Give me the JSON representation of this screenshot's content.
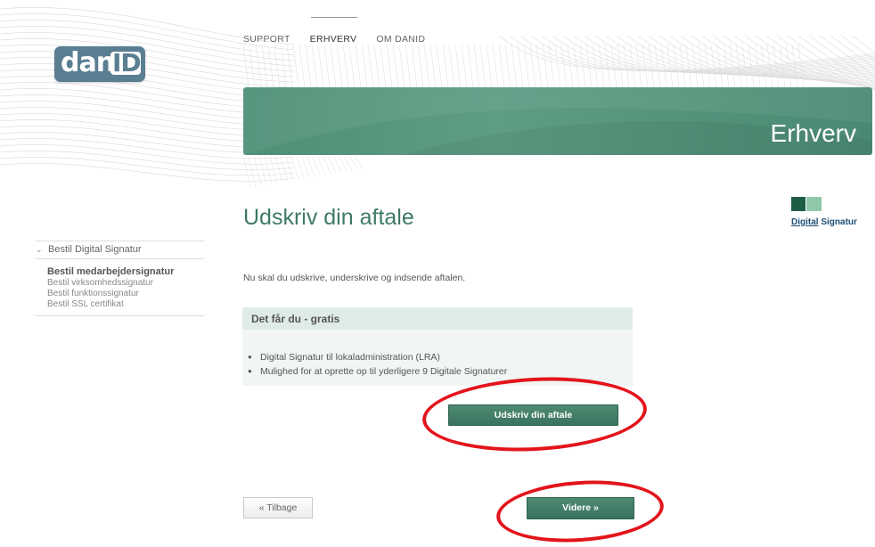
{
  "nav": {
    "items": [
      {
        "label": "SUPPORT"
      },
      {
        "label": "ERHVERV",
        "active": true
      },
      {
        "label": "OM DANID"
      }
    ]
  },
  "logo": {
    "part1": "dan",
    "part2": "ID"
  },
  "banner": {
    "title": "Erhverv"
  },
  "ds_logo": {
    "part1": "Digital",
    "part2": " Signatur"
  },
  "page": {
    "heading": "Udskriv din aftale",
    "intro": "Nu skal du udskrive, underskrive og indsende aftalen."
  },
  "sidebar": {
    "section": "Bestil Digital Signatur",
    "items": [
      {
        "label": "Bestil medarbejdersignatur",
        "current": true
      },
      {
        "label": "Bestil virksomhedssignatur"
      },
      {
        "label": "Bestil funktionssignatur"
      },
      {
        "label": "Bestil SSL certifikat"
      }
    ]
  },
  "box": {
    "title": "Det får du - gratis",
    "items": [
      "Digital Signatur til lokaladministration (LRA)",
      "Mulighed for at oprette op til yderligere 9 Digitale Signaturer"
    ]
  },
  "buttons": {
    "print": "Udskriv din aftale",
    "back": "« Tilbage",
    "next": "Videre »"
  },
  "colors": {
    "accent": "#4e8f76",
    "logo": "#5a7f93",
    "annotation": "#e3141b"
  }
}
